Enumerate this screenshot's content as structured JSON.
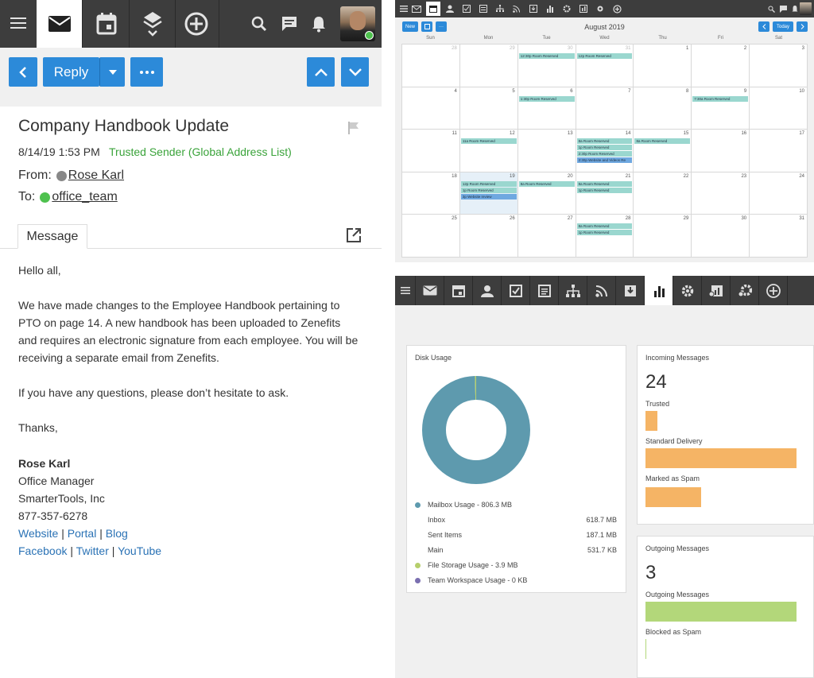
{
  "email": {
    "reply_label": "Reply",
    "subject": "Company Handbook Update",
    "date": "8/14/19 1:53 PM",
    "trust": "Trusted Sender (Global Address List)",
    "from_label": "From:",
    "from_name": "Rose Karl",
    "to_label": "To:",
    "to_name": "office_team",
    "tab_label": "Message",
    "greeting": "Hello all,",
    "para1_l1": "We have made changes to the Employee Handbook pertaining to",
    "para1_l2": "PTO on page 14.  A new handbook has been uploaded to Zenefits",
    "para1_l3": "and requires an electronic signature from each employee.  You will be",
    "para1_l4": "receiving a separate email from Zenefits.",
    "para2": "If you have any questions, please don’t hesitate to ask.",
    "thanks": "Thanks,",
    "sig_name": "Rose Karl",
    "sig_title": "Office Manager",
    "sig_company": "SmarterTools, Inc",
    "sig_phone": "877-357-6278",
    "link_website": "Website",
    "link_portal": "Portal",
    "link_blog": "Blog",
    "link_facebook": "Facebook",
    "link_twitter": "Twitter",
    "link_youtube": "YouTube",
    "sep": "|"
  },
  "calendar": {
    "new_label": "New",
    "today_label": "Today",
    "month_title": "August 2019",
    "days": [
      "Sun",
      "Mon",
      "Tue",
      "Wed",
      "Thu",
      "Fri",
      "Sat"
    ],
    "weeks": [
      [
        {
          "n": "28",
          "dim": true,
          "ev": []
        },
        {
          "n": "29",
          "dim": true,
          "ev": []
        },
        {
          "n": "30",
          "dim": true,
          "ev": [
            "12:30p Room Reserved"
          ]
        },
        {
          "n": "31",
          "dim": true,
          "ev": [
            "12p Room Reserved"
          ]
        },
        {
          "n": "1",
          "ev": []
        },
        {
          "n": "2",
          "ev": []
        },
        {
          "n": "3",
          "ev": []
        }
      ],
      [
        {
          "n": "4",
          "ev": []
        },
        {
          "n": "5",
          "ev": []
        },
        {
          "n": "6",
          "ev": [
            "1:30p Room Reserved"
          ]
        },
        {
          "n": "7",
          "ev": []
        },
        {
          "n": "8",
          "ev": []
        },
        {
          "n": "9",
          "ev": [
            "7:30a Room Reserved"
          ]
        },
        {
          "n": "10",
          "ev": []
        }
      ],
      [
        {
          "n": "11",
          "ev": []
        },
        {
          "n": "12",
          "ev": [
            "11a Room Reserved"
          ]
        },
        {
          "n": "13",
          "ev": []
        },
        {
          "n": "14",
          "ev": [
            "8a Room Reserved",
            "1p Room Reserved",
            "2:30p Room Reserved",
            "2:30p Website and Videos Re"
          ]
        },
        {
          "n": "15",
          "ev": [
            "8a Room Reserved"
          ]
        },
        {
          "n": "16",
          "ev": []
        },
        {
          "n": "17",
          "ev": []
        }
      ],
      [
        {
          "n": "18",
          "ev": []
        },
        {
          "n": "19",
          "today": true,
          "ev": [
            "12p Room Reserved",
            "1p Room Reserved",
            "3p Website review"
          ]
        },
        {
          "n": "20",
          "ev": [
            "8a Room Reserved"
          ]
        },
        {
          "n": "21",
          "ev": [
            "8a Room Reserved",
            "1p Room Reserved"
          ]
        },
        {
          "n": "22",
          "ev": []
        },
        {
          "n": "23",
          "ev": []
        },
        {
          "n": "24",
          "ev": []
        }
      ],
      [
        {
          "n": "25",
          "ev": []
        },
        {
          "n": "26",
          "ev": []
        },
        {
          "n": "27",
          "ev": []
        },
        {
          "n": "28",
          "ev": [
            "8a Room Reserved",
            "1p Room Reserved"
          ]
        },
        {
          "n": "29",
          "ev": []
        },
        {
          "n": "30",
          "ev": []
        },
        {
          "n": "31",
          "ev": []
        }
      ]
    ]
  },
  "dashboard": {
    "disk_title": "Disk Usage",
    "mailbox_label": "Mailbox Usage - 806.3 MB",
    "inbox_label": "Inbox",
    "inbox_val": "618.7 MB",
    "sent_label": "Sent Items",
    "sent_val": "187.1 MB",
    "main_label": "Main",
    "main_val": "531.7 KB",
    "file_label": "File Storage Usage - 3.9 MB",
    "team_label": "Team Workspace Usage - 0 KB",
    "incoming_title": "Incoming Messages",
    "incoming_count": "24",
    "trusted_label": "Trusted",
    "standard_label": "Standard Delivery",
    "spam_label": "Marked as Spam",
    "outgoing_title": "Outgoing Messages",
    "outgoing_count": "3",
    "outgoing_label": "Outgoing Messages",
    "blocked_label": "Blocked as Spam",
    "colors": {
      "mailbox": "#5e9aae",
      "file": "#b6cf6c",
      "team": "#7a6fb0",
      "incoming": "#f5b465",
      "outgoing": "#b3d77a"
    }
  },
  "chart_data": [
    {
      "type": "pie",
      "title": "Disk Usage",
      "categories": [
        "Mailbox Usage",
        "File Storage Usage",
        "Team Workspace Usage"
      ],
      "values": [
        806.3,
        3.9,
        0
      ],
      "unit": "MB"
    },
    {
      "type": "bar",
      "title": "Incoming Messages",
      "categories": [
        "Trusted",
        "Standard Delivery",
        "Marked as Spam"
      ],
      "values": [
        0.08,
        1.0,
        0.37
      ]
    },
    {
      "type": "bar",
      "title": "Outgoing Messages",
      "categories": [
        "Outgoing Messages",
        "Blocked as Spam"
      ],
      "values": [
        1.0,
        0.0
      ]
    }
  ]
}
